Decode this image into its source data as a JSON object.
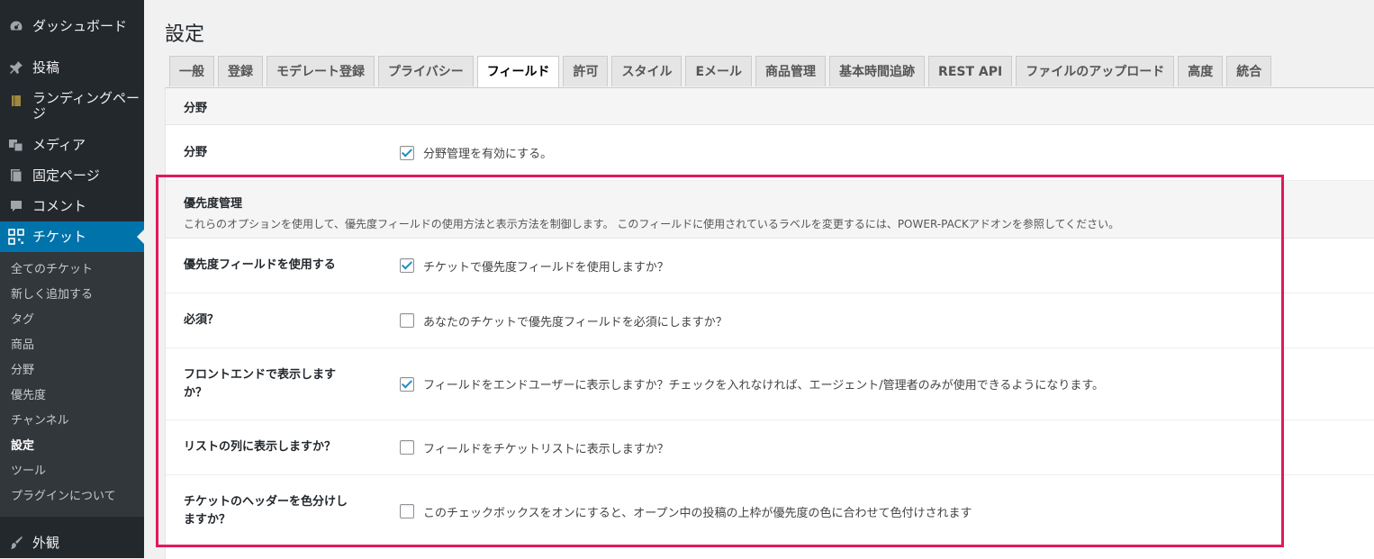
{
  "sidebar": {
    "items": [
      {
        "label": "ダッシュボード",
        "icon": "dashboard-icon"
      },
      {
        "label": "投稿",
        "icon": "pin-icon"
      },
      {
        "label": "ランディングページ",
        "icon": "book-icon"
      },
      {
        "label": "メディア",
        "icon": "media-icon"
      },
      {
        "label": "固定ページ",
        "icon": "page-icon"
      },
      {
        "label": "コメント",
        "icon": "comment-icon"
      },
      {
        "label": "チケット",
        "icon": "ticket-grid-icon"
      }
    ],
    "submenu": [
      "全てのチケット",
      "新しく追加する",
      "タグ",
      "商品",
      "分野",
      "優先度",
      "チャンネル",
      "設定",
      "ツール",
      "プラグインについて"
    ],
    "bottom_item": {
      "label": "外観",
      "icon": "brush-icon"
    }
  },
  "page": {
    "title": "設定"
  },
  "tabs": [
    "一般",
    "登録",
    "モデレート登録",
    "プライバシー",
    "フィールド",
    "許可",
    "スタイル",
    "Eメール",
    "商品管理",
    "基本時間追跡",
    "REST API",
    "ファイルのアップロード",
    "高度",
    "統合"
  ],
  "active_tab": "フィールド",
  "section1": {
    "title": "分野",
    "row": {
      "label": "分野",
      "text": "分野管理を有効にする。",
      "checked": true
    }
  },
  "section2": {
    "title": "優先度管理",
    "description": "これらのオプションを使用して、優先度フィールドの使用方法と表示方法を制御します。 このフィールドに使用されているラベルを変更するには、POWER-PACKアドオンを参照してください。",
    "rows": [
      {
        "label": "優先度フィールドを使用する",
        "text": "チケットで優先度フィールドを使用しますか？",
        "checked": true
      },
      {
        "label": "必須？",
        "text": "あなたのチケットで優先度フィールドを必須にしますか？",
        "checked": false
      },
      {
        "label_line1": "フロントエンドで表示します",
        "label_line2": "か？",
        "text": "フィールドをエンドユーザーに表示しますか？チェックを入れなければ、エージェント/管理者のみが使用できるようになります。",
        "checked": true
      },
      {
        "label": "リストの列に表示しますか？",
        "text": "フィールドをチケットリストに表示しますか？",
        "checked": false
      },
      {
        "label_line1": "チケットのヘッダーを色分けし",
        "label_line2": "ますか？",
        "text": "このチェックボックスをオンにすると、オープン中の投稿の上枠が優先度の色に合わせて色付けされます",
        "checked": false
      }
    ]
  },
  "colors": {
    "sidebar_bg": "#23282d",
    "accent": "#0073aa",
    "highlight": "#e3175f",
    "check": "#1e8cbe"
  }
}
